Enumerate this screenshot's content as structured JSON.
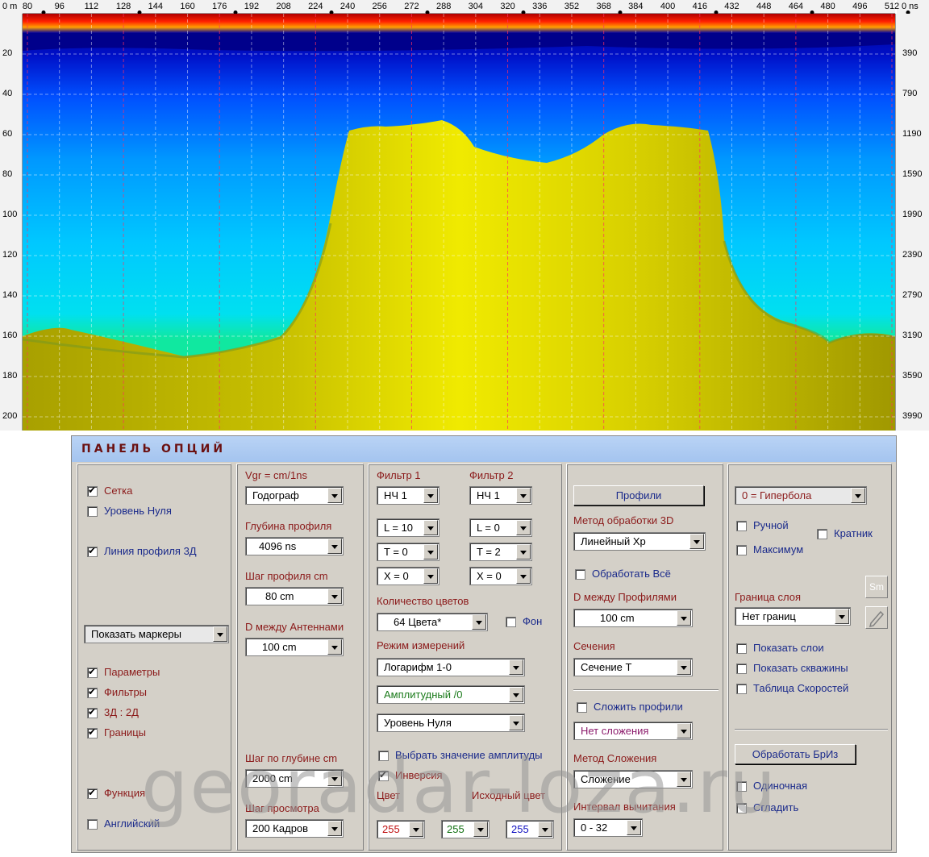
{
  "ruler": {
    "corner_left": "0 m",
    "corner_right": "0 ns",
    "top_ticks": [
      "80",
      "96",
      "112",
      "128",
      "144",
      "160",
      "176",
      "192",
      "208",
      "224",
      "240",
      "256",
      "272",
      "288",
      "304",
      "320",
      "336",
      "352",
      "368",
      "384",
      "400",
      "416",
      "432",
      "448",
      "464",
      "480",
      "496",
      "512"
    ],
    "left_ticks": [
      "20",
      "40",
      "60",
      "80",
      "100",
      "120",
      "140",
      "160",
      "180",
      "200"
    ],
    "right_ticks": [
      "390",
      "790",
      "1190",
      "1590",
      "1990",
      "2390",
      "2790",
      "3190",
      "3590",
      "3990"
    ]
  },
  "colors": {
    "accent": "#8b1a1a",
    "label_blue": "#1a2a8b",
    "panel_bg": "#d4d0c8"
  },
  "panel": {
    "title": "ПАНЕЛЬ ОПЦИЙ",
    "col1": {
      "setka": "Сетка",
      "uroven_nulya": "Уровень Нуля",
      "liniya_profilya": "Линия профиля 3Д",
      "markers_select": "Показать маркеры",
      "parametry": "Параметры",
      "filtry": "Фильтры",
      "d3d2": "3Д : 2Д",
      "granicy": "Границы",
      "funkciya": "Функция",
      "angliyskiy": "Английский"
    },
    "col2": {
      "vgr": "Vgr = cm/1ns",
      "vgr_value": "Годограф",
      "glubina_label": "Глубина профиля",
      "glubina_value": "4096  ns",
      "shag_label": "Шаг профиля cm",
      "shag_value": "80 cm",
      "dant_label": "D между Антеннами",
      "dant_value": "100 cm",
      "shag_gl_label": "Шаг по глубине cm",
      "shag_gl_value": "2000 cm",
      "shag_pr_label": "Шаг просмотра",
      "shag_pr_value": "200 Кадров"
    },
    "col3": {
      "f1": "Фильтр 1",
      "f2": "Фильтр 2",
      "f1_type": "НЧ 1",
      "f2_type": "НЧ 1",
      "f1_l": "L = 10",
      "f2_l": "L = 0",
      "f1_t": "T = 0",
      "f2_t": "T = 2",
      "f1_x": "X = 0",
      "f2_x": "X = 0",
      "kol_label": "Количество цветов",
      "kol_value": "64 Цвета*",
      "fon": "Фон",
      "rezhim_label": "Режим измерений",
      "rezhim_value": "Логарифм 1-0",
      "ampl_value": "Амплитудный /0",
      "uroven_value": "Уровень Нуля",
      "vybrat": "Выбрать значение амплитуды",
      "inversiya": "Инверсия",
      "cvet": "Цвет",
      "ishodny": "Исходный цвет",
      "r": "255",
      "g": "255",
      "b": "255"
    },
    "col4": {
      "profili_btn": "Профили",
      "metod3d_label": "Метод обработки 3D",
      "metod3d_value": "Линейный Хр",
      "obrab_vse": "Обработать Всё",
      "dprof_label": "D между Профилями",
      "dprof_value": "100 cm",
      "secheniya_label": "Сечения",
      "secheniya_value": "Сечение T",
      "slozhit": "Сложить профили",
      "slozh_value": "Нет сложения",
      "metod_sl_label": "Метод Сложения",
      "metod_sl_value": "Сложение",
      "interval_label": "Интервал вычитания",
      "interval_value": "0 - 32"
    },
    "col5": {
      "hyper_value": "0 = Гипербола",
      "ruchnoy": "Ручной",
      "kratnik": "Кратник",
      "maksimum": "Максимум",
      "sm": "Sm",
      "granica_label": "Граница слоя",
      "granica_value": "Нет границ",
      "pokazat_sloi": "Показать слои",
      "pokazat_skv": "Показать скважины",
      "tablica": "Таблица Скоростей",
      "obrab_briz": "Обработать БрИз",
      "odinochnaya": "Одиночная",
      "sgladit": "Сгладить"
    }
  },
  "watermark": "georadar-loza.ru"
}
